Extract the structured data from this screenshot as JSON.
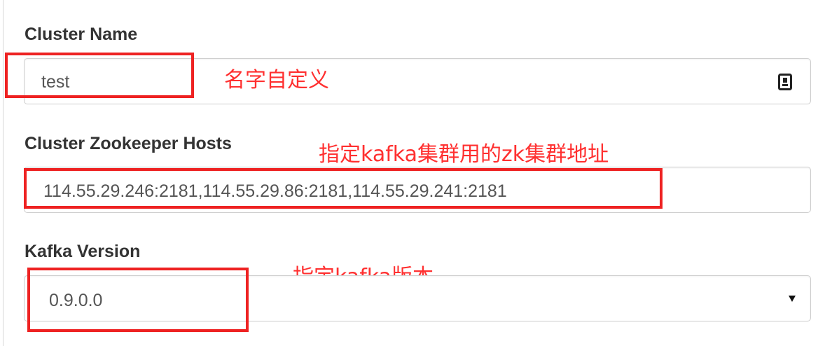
{
  "cluster_name": {
    "label": "Cluster Name",
    "value": "test",
    "annotation": "名字自定义",
    "icon": "keyboard-icon"
  },
  "zk_hosts": {
    "label": "Cluster Zookeeper Hosts",
    "value": "114.55.29.246:2181,114.55.29.86:2181,114.55.29.241:2181",
    "annotation": "指定kafka集群用的zk集群地址"
  },
  "kafka_version": {
    "label": "Kafka Version",
    "selected": "0.9.0.0",
    "annotation": "指定kafka版本",
    "icon": "caret-down-icon"
  },
  "colors": {
    "annotation": "#ee2222",
    "label": "#333333",
    "input_border": "#cfcfcf"
  }
}
